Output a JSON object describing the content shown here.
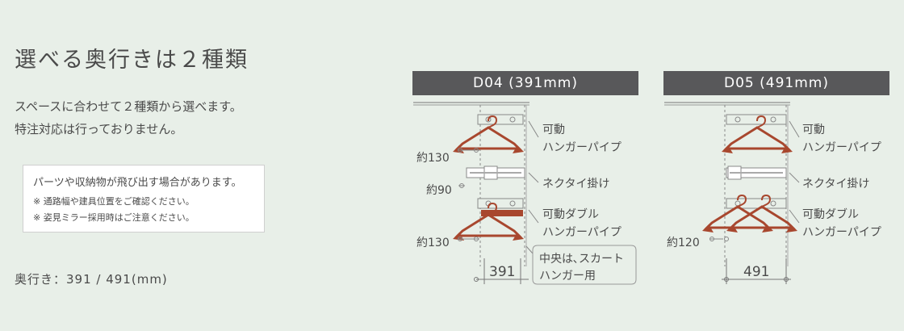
{
  "title": "選べる奥行きは２種類",
  "description": [
    "スペースに合わせて２種類から選べます。",
    "特注対応は行っておりません。"
  ],
  "note": {
    "main": "パーツや収納物が飛び出す場合があります。",
    "lines": [
      "※ 通路幅や建具位置をご確認ください。",
      "※ 姿見ミラー採用時はご注意ください。"
    ]
  },
  "depth_text": "奥行き：391 / 491(mm)",
  "panels": [
    {
      "header": "D04 (391mm)",
      "labels": {
        "hanger": [
          "可動",
          "ハンガーパイプ"
        ],
        "tie": "ネクタイ掛け",
        "double": [
          "可動ダブル",
          "ハンガーパイプ"
        ],
        "skirt": [
          "中央は､スカート",
          "ハンガー用"
        ]
      },
      "dims": {
        "top": "約130",
        "mid": "約90",
        "bottom": "約130",
        "depth": "391"
      }
    },
    {
      "header": "D05 (491mm)",
      "labels": {
        "hanger": [
          "可動",
          "ハンガーパイプ"
        ],
        "tie": "ネクタイ掛け",
        "double": [
          "可動ダブル",
          "ハンガーパイプ"
        ]
      },
      "dims": {
        "bottom": "約120",
        "depth": "491"
      }
    }
  ],
  "colors": {
    "background": "#e8efe8",
    "header": "#58585a",
    "hanger": "#a8472e",
    "line": "#777777"
  }
}
